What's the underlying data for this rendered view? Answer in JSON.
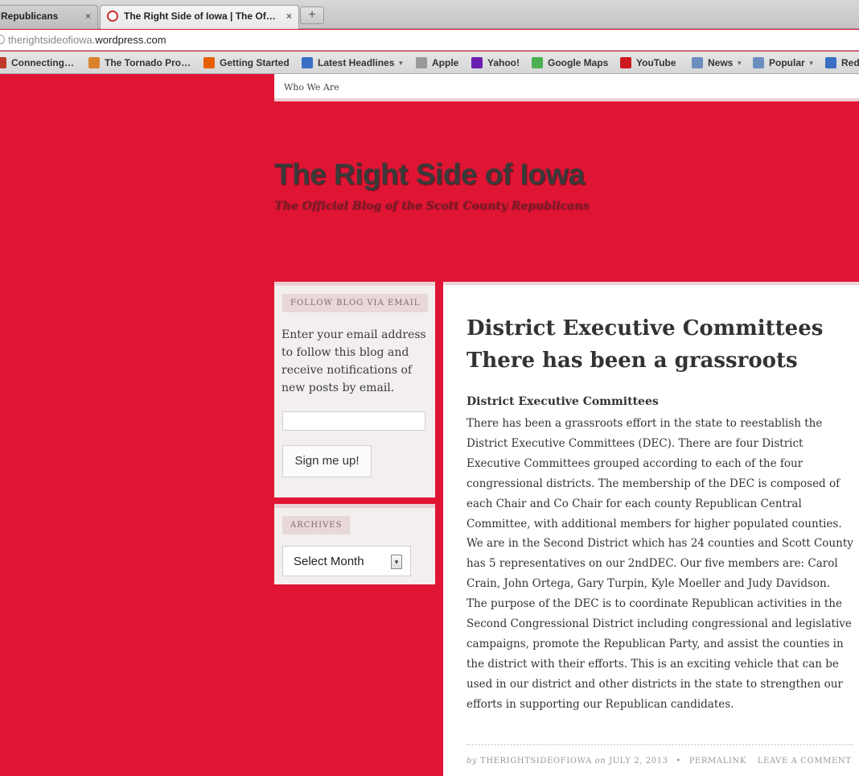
{
  "browser": {
    "tabs": [
      {
        "label": "Republicans",
        "close": "×"
      },
      {
        "label": "The Right Side of Iowa | The Of…",
        "close": "×"
      }
    ],
    "new_tab": "+",
    "url_host": "therightsideofiowa.",
    "url_domain": "wordpress.com",
    "bookmarks": [
      {
        "label": "Connecting…",
        "icon": "key-icon",
        "color": "#c0392b"
      },
      {
        "label": "The Tornado Pro…",
        "icon": "tornado-icon",
        "color": "#d9822b"
      },
      {
        "label": "Getting Started",
        "icon": "firefox-icon",
        "color": "#e66000"
      },
      {
        "label": "Latest Headlines",
        "icon": "rss-icon",
        "color": "#3a6fc4",
        "dropdown": true
      },
      {
        "label": "Apple",
        "icon": "page-icon",
        "color": "#999999"
      },
      {
        "label": "Yahoo!",
        "icon": "yahoo-icon",
        "color": "#6b1fb1"
      },
      {
        "label": "Google Maps",
        "icon": "maps-icon",
        "color": "#4caf50"
      },
      {
        "label": "YouTube",
        "icon": "youtube-icon",
        "color": "#cc181e"
      },
      {
        "label": "News",
        "icon": "folder-icon",
        "color": "#6c8ebf",
        "dropdown": true
      },
      {
        "label": "Popular",
        "icon": "folder-icon",
        "color": "#6c8ebf",
        "dropdown": true
      },
      {
        "label": "Red",
        "icon": "rss-icon",
        "color": "#3a6fc4"
      }
    ]
  },
  "nav": {
    "who_we_are": "Who We Are"
  },
  "site": {
    "title": "The Right Side of Iowa",
    "description": "The Official Blog of the Scott County Republicans"
  },
  "sidebar": {
    "follow": {
      "title": "FOLLOW BLOG VIA EMAIL",
      "text": "Enter your email address to follow this blog and receive notifications of new posts by email.",
      "email_placeholder": "",
      "button": "Sign me up!"
    },
    "archives": {
      "title": "ARCHIVES",
      "select_value": "Select Month"
    }
  },
  "post": {
    "title": "District Executive Committees There has been a grassroots",
    "subhead": "District Executive Committees",
    "body": "There has been a grassroots effort in the state to reestablish the District Executive Committees (DEC). There are four District Executive Committees grouped according to each of the four congressional districts. The membership of the DEC is composed of each Chair and Co Chair for each county Republican Central Committee, with additional members for higher populated counties. We are in the Second District which has 24 counties and Scott County has 5 representatives on our 2ndDEC. Our five members are: Carol Crain, John Ortega, Gary Turpin, Kyle Moeller and Judy Davidson.   The purpose of the DEC is to coordinate Republican activities in the Second Congressional District including congressional and legislative campaigns, promote the Republican Party, and assist the counties in the district with their efforts. This is an exciting vehicle that can be used in our district and other districts in the state to strengthen our efforts in supporting our Republican candidates.",
    "meta": {
      "by": "by",
      "author": "THERIGHTSIDEOFIOWA",
      "on": "on",
      "date": "JULY 2, 2013",
      "separator": "•",
      "permalink": "PERMALINK",
      "comment": "LEAVE A COMMENT"
    }
  },
  "colors": {
    "background": "#e01534",
    "accent_border": "#ecd0d4"
  }
}
